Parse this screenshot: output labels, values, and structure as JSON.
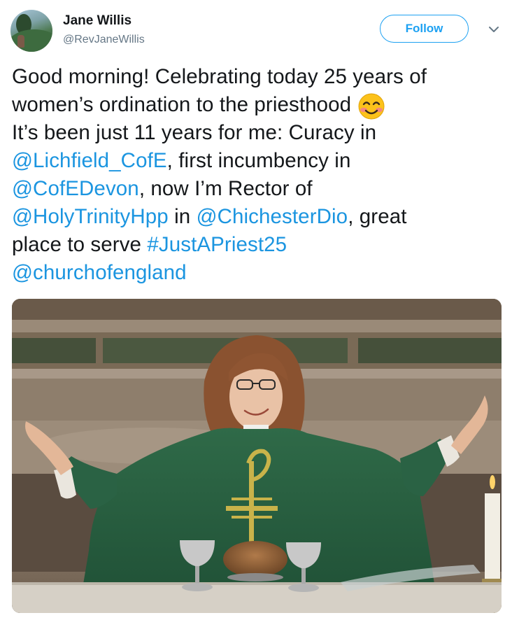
{
  "author": {
    "name": "Jane Willis",
    "handle": "@RevJaneWillis"
  },
  "actions": {
    "follow_label": "Follow"
  },
  "tweet": {
    "line1": "Good morning! Celebrating today 25 years of",
    "line2_text": "women’s ordination to the priesthood ",
    "line3": "It’s been just 11 years for me: Curacy in",
    "line4_link": "@Lichfield_CofE",
    "line4_text": ", first incumbency in",
    "line5_link": "@CofEDevon",
    "line5_text": ", now I’m Rector of",
    "line6_link1": "@HolyTrinityHpp",
    "line6_text1": " in ",
    "line6_link2": "@ChichesterDio",
    "line6_text2": ", great",
    "line7_text": "place to serve ",
    "line7_hashtag": "#JustAPriest25",
    "line8_link": "@churchofengland",
    "emoji": "smiling-face-with-smiling-eyes"
  },
  "colors": {
    "text": "#14171a",
    "muted": "#657786",
    "link": "#1b95e0",
    "accent": "#1da1f2"
  }
}
